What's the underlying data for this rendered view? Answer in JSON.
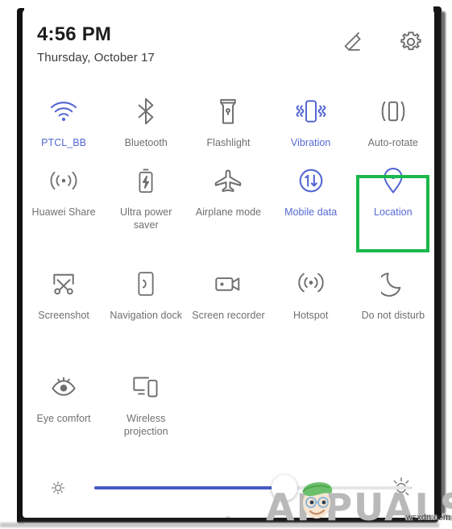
{
  "statusbar": {
    "time": "4:56 PM",
    "date": "Thursday, October 17"
  },
  "header_actions": [
    {
      "name": "edit-icon",
      "label": "Edit"
    },
    {
      "name": "gear-icon",
      "label": "Settings"
    }
  ],
  "accent": {
    "active_blue": "#5568d3",
    "inactive_gray": "#6f6f6f",
    "highlight_green": "#19b84a",
    "slider_fill": "#4a5bc4"
  },
  "tiles": [
    [
      {
        "label": "PTCL_BB",
        "icon": "wifi-icon",
        "active": true
      },
      {
        "label": "Bluetooth",
        "icon": "bluetooth-icon",
        "active": false
      },
      {
        "label": "Flashlight",
        "icon": "flashlight-icon",
        "active": false
      },
      {
        "label": "Vibration",
        "icon": "vibration-icon",
        "active": true
      },
      {
        "label": "Auto-rotate",
        "icon": "auto-rotate-icon",
        "active": false
      }
    ],
    [
      {
        "label": "Huawei Share",
        "icon": "huawei-share-icon",
        "active": false
      },
      {
        "label": "Ultra power saver",
        "icon": "battery-bolt-icon",
        "active": false
      },
      {
        "label": "Airplane mode",
        "icon": "airplane-icon",
        "active": false
      },
      {
        "label": "Mobile data",
        "icon": "mobile-data-icon",
        "active": true
      },
      {
        "label": "Location",
        "icon": "location-pin-icon",
        "active": true,
        "highlighted": true
      }
    ],
    [
      {
        "label": "Screenshot",
        "icon": "screenshot-icon",
        "active": false
      },
      {
        "label": "Navigation dock",
        "icon": "navigation-dock-icon",
        "active": false
      },
      {
        "label": "Screen recorder",
        "icon": "screen-recorder-icon",
        "active": false
      },
      {
        "label": "Hotspot",
        "icon": "hotspot-icon",
        "active": false
      },
      {
        "label": "Do not disturb",
        "icon": "moon-icon",
        "active": false
      }
    ],
    [
      {
        "label": "Eye comfort",
        "icon": "eye-comfort-icon",
        "active": false
      },
      {
        "label": "Wireless projection",
        "icon": "wireless-projection-icon",
        "active": false
      }
    ]
  ],
  "brightness": {
    "name": "brightness-slider",
    "value_percent": 60,
    "low_icon": "sun-small-icon",
    "high_icon": "sun-large-icon"
  },
  "collapse_handle": {
    "icon": "chevron-up-icon"
  },
  "watermark": {
    "text": "APPUALS",
    "site": "wsxdn.com"
  }
}
